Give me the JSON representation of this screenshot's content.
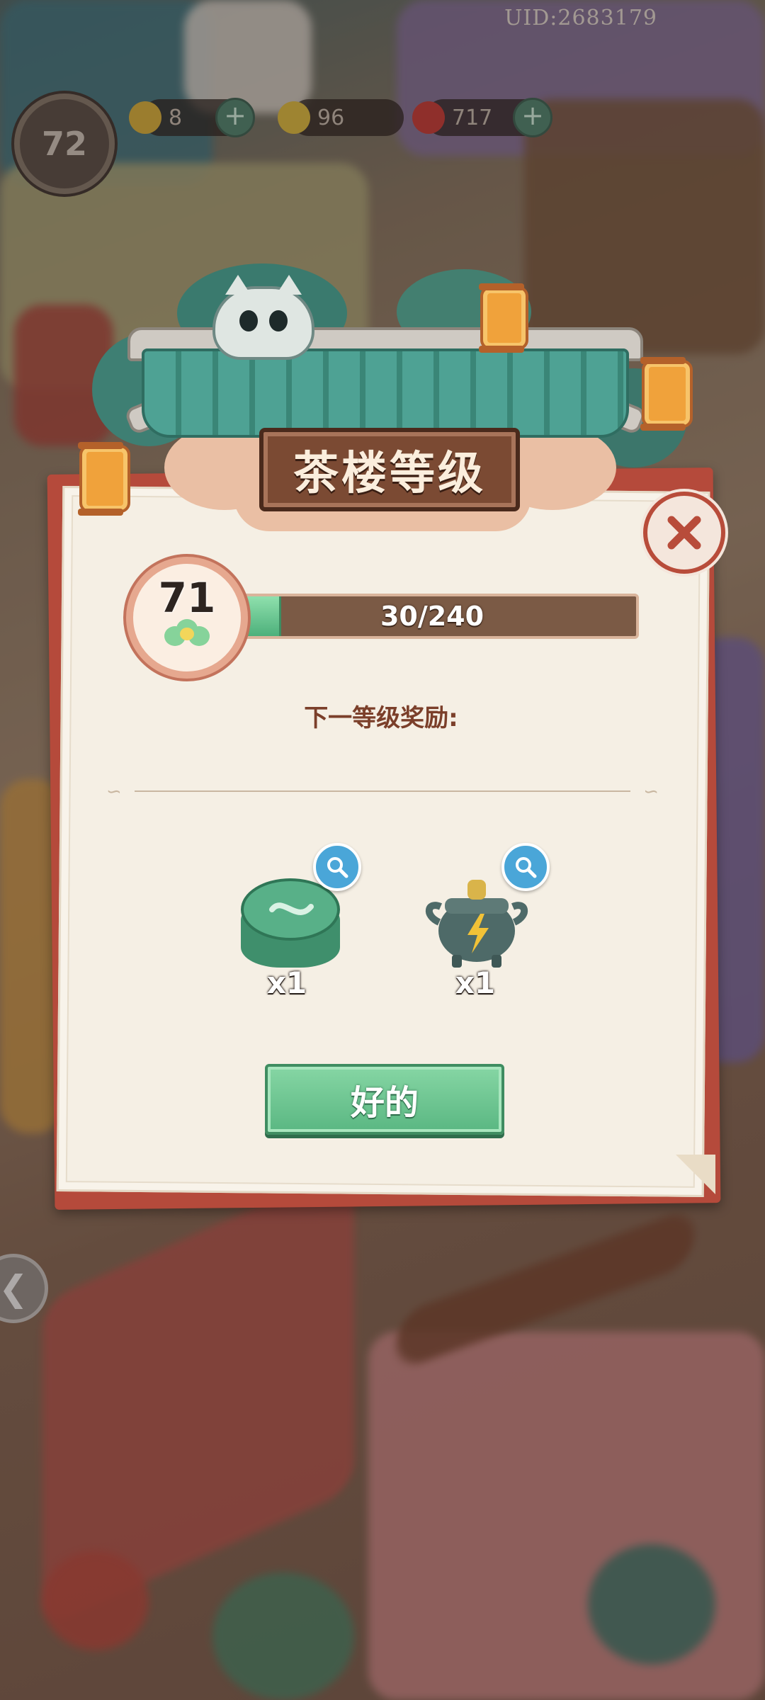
{
  "header": {
    "uid": "UID:2683179"
  },
  "hud": {
    "level": "72",
    "resources": [
      {
        "icon": "lightning-coin-icon",
        "value": "8"
      },
      {
        "icon": "gold-coin-icon",
        "value": "96"
      },
      {
        "icon": "red-gem-icon",
        "value": "717"
      }
    ]
  },
  "dialog": {
    "title": "茶楼等级",
    "level": "71",
    "progress_text": "30/240",
    "progress_fraction": 0.125,
    "reward_heading": "下一等级奖励:",
    "rewards": [
      {
        "icon": "green-tin-box-icon",
        "count": "x1"
      },
      {
        "icon": "bronze-teapot-energy-icon",
        "count": "x1"
      }
    ],
    "ok_label": "好的"
  },
  "colors": {
    "panel": "#f5efe4",
    "frame_red": "#b54a3b",
    "progress_fill": "#4db07b",
    "button_green": "#5ab782",
    "heading_brown": "#7b3f2a"
  }
}
